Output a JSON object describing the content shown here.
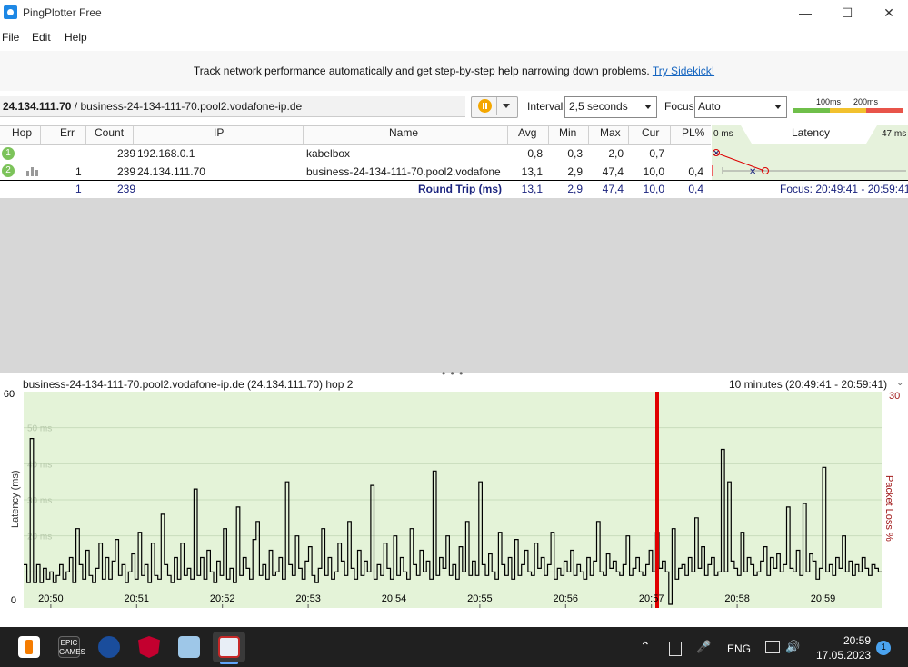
{
  "window": {
    "title": "PingPlotter Free",
    "minimize_glyph": "—",
    "maximize_glyph": "☐",
    "close_glyph": "✕"
  },
  "menu": {
    "file": "File",
    "edit": "Edit",
    "help": "Help"
  },
  "banner": {
    "text": "Track network performance automatically and get step-by-step help narrowing down problems.",
    "link": "Try Sidekick!"
  },
  "target": {
    "ip": "24.134.111.70",
    "sep": " / ",
    "host": "business-24-134-111-70.pool2.vodafone-ip.de"
  },
  "controls": {
    "interval_label": "Interval",
    "interval_value": "2,5 seconds",
    "focus_label": "Focus",
    "focus_value": "Auto",
    "scale_100": "100ms",
    "scale_200": "200ms",
    "scale_colors": [
      "#6fbf4a",
      "#f2c12e",
      "#e8544a"
    ]
  },
  "table": {
    "headers": {
      "hop": "Hop",
      "err": "Err",
      "count": "Count",
      "ip": "IP",
      "name": "Name",
      "avg": "Avg",
      "min": "Min",
      "max": "Max",
      "cur": "Cur",
      "pl": "PL%",
      "lat_min": "0 ms",
      "latency": "Latency",
      "lat_max": "47 ms"
    },
    "rows": [
      {
        "hop": "1",
        "err": "",
        "count": "239",
        "ip": "192.168.0.1",
        "name": "kabelbox",
        "avg": "0,8",
        "min": "0,3",
        "max": "2,0",
        "cur": "0,7",
        "pl": ""
      },
      {
        "hop": "2",
        "err": "1",
        "count": "239",
        "ip": "24.134.111.70",
        "name": "business-24-134-111-70.pool2.vodafone",
        "avg": "13,1",
        "min": "2,9",
        "max": "47,4",
        "cur": "10,0",
        "pl": "0,4"
      }
    ],
    "summary": {
      "err": "1",
      "count": "239",
      "label": "Round Trip (ms)",
      "avg": "13,1",
      "min": "2,9",
      "max": "47,4",
      "cur": "10,0",
      "pl": "0,4",
      "focus": "Focus: 20:49:41 - 20:59:41"
    }
  },
  "graph": {
    "title": "business-24-134-111-70.pool2.vodafone-ip.de (24.134.111.70) hop 2",
    "range": "10 minutes (20:49:41 - 20:59:41)",
    "drag_handle": "• • •",
    "collapse_glyph": "⌄"
  },
  "chart_data": {
    "type": "line",
    "ylabel": "Latency (ms)",
    "y2label": "Packet Loss %",
    "ylim": [
      0,
      60
    ],
    "y2lim": [
      0,
      30
    ],
    "y_ticks": [
      "60",
      "0"
    ],
    "y2_ticks": [
      "30"
    ],
    "grid_labels": [
      "50 ms",
      "40 ms",
      "30 ms",
      "20 ms"
    ],
    "x_ticks": [
      "20:50",
      "20:51",
      "20:52",
      "20:53",
      "20:54",
      "20:55",
      "20:56",
      "20:57",
      "20:58",
      "20:59"
    ],
    "loss_marker_time": "20:57:04",
    "line_color": "#000000",
    "loss_color": "#e00000",
    "background": "#e4f3d8",
    "series": [
      {
        "values": [
          12,
          7,
          47,
          7,
          12,
          7,
          11,
          8,
          10,
          7,
          9,
          12,
          8,
          10,
          14,
          7,
          22,
          12,
          8,
          16,
          9,
          7,
          11,
          18,
          8,
          14,
          8,
          13,
          19,
          9,
          12,
          7,
          10,
          15,
          8,
          21,
          9,
          12,
          7,
          18,
          9,
          8,
          26,
          12,
          9,
          7,
          14,
          8,
          18,
          9,
          11,
          8,
          33,
          9,
          14,
          8,
          16,
          10,
          7,
          13,
          9,
          22,
          8,
          11,
          7,
          28,
          9,
          14,
          11,
          8,
          19,
          24,
          9,
          12,
          8,
          16,
          9,
          10,
          14,
          8,
          35,
          12,
          9,
          20,
          11,
          8,
          13,
          17,
          9,
          7,
          11,
          22,
          9,
          14,
          8,
          10,
          18,
          13,
          9,
          24,
          11,
          8,
          16,
          9,
          13,
          10,
          34,
          8,
          12,
          9,
          18,
          11,
          8,
          20,
          9,
          14,
          10,
          8,
          22,
          12,
          9,
          16,
          10,
          13,
          8,
          38,
          9,
          14,
          11,
          20,
          9,
          12,
          8,
          17,
          10,
          24,
          9,
          13,
          9,
          35,
          12,
          9,
          15,
          10,
          8,
          21,
          12,
          9,
          14,
          8,
          19,
          9,
          12,
          16,
          10,
          9,
          18,
          11,
          14,
          9,
          12,
          21,
          8,
          11,
          9,
          13,
          10,
          16,
          9,
          12,
          10,
          8,
          14,
          9,
          13,
          24,
          10,
          9,
          15,
          11,
          13,
          10,
          9,
          12,
          20,
          9,
          11,
          14,
          10,
          9,
          12,
          16,
          10,
          21,
          11,
          13,
          10,
          1,
          22,
          8,
          11,
          12,
          9,
          14,
          10,
          25,
          11,
          17,
          9,
          12,
          14,
          9,
          10,
          44,
          10,
          35,
          13,
          11,
          9,
          21,
          10,
          14,
          12,
          9,
          10,
          13,
          17,
          9,
          14,
          11,
          15,
          10,
          12,
          28,
          11,
          10,
          16,
          9,
          29,
          10,
          15,
          13,
          8,
          11,
          39,
          10,
          12,
          9,
          14,
          11,
          20,
          10,
          13,
          9,
          12,
          10,
          14,
          11,
          9,
          12,
          11,
          10
        ]
      }
    ]
  },
  "taskbar": {
    "time": "20:59",
    "date": "17.05.2023",
    "lang": "ENG",
    "notif_count": "1",
    "epic_label": "EPIC GAMES",
    "chevron": "⌃",
    "mic": "🎤",
    "speaker": "🔊"
  }
}
